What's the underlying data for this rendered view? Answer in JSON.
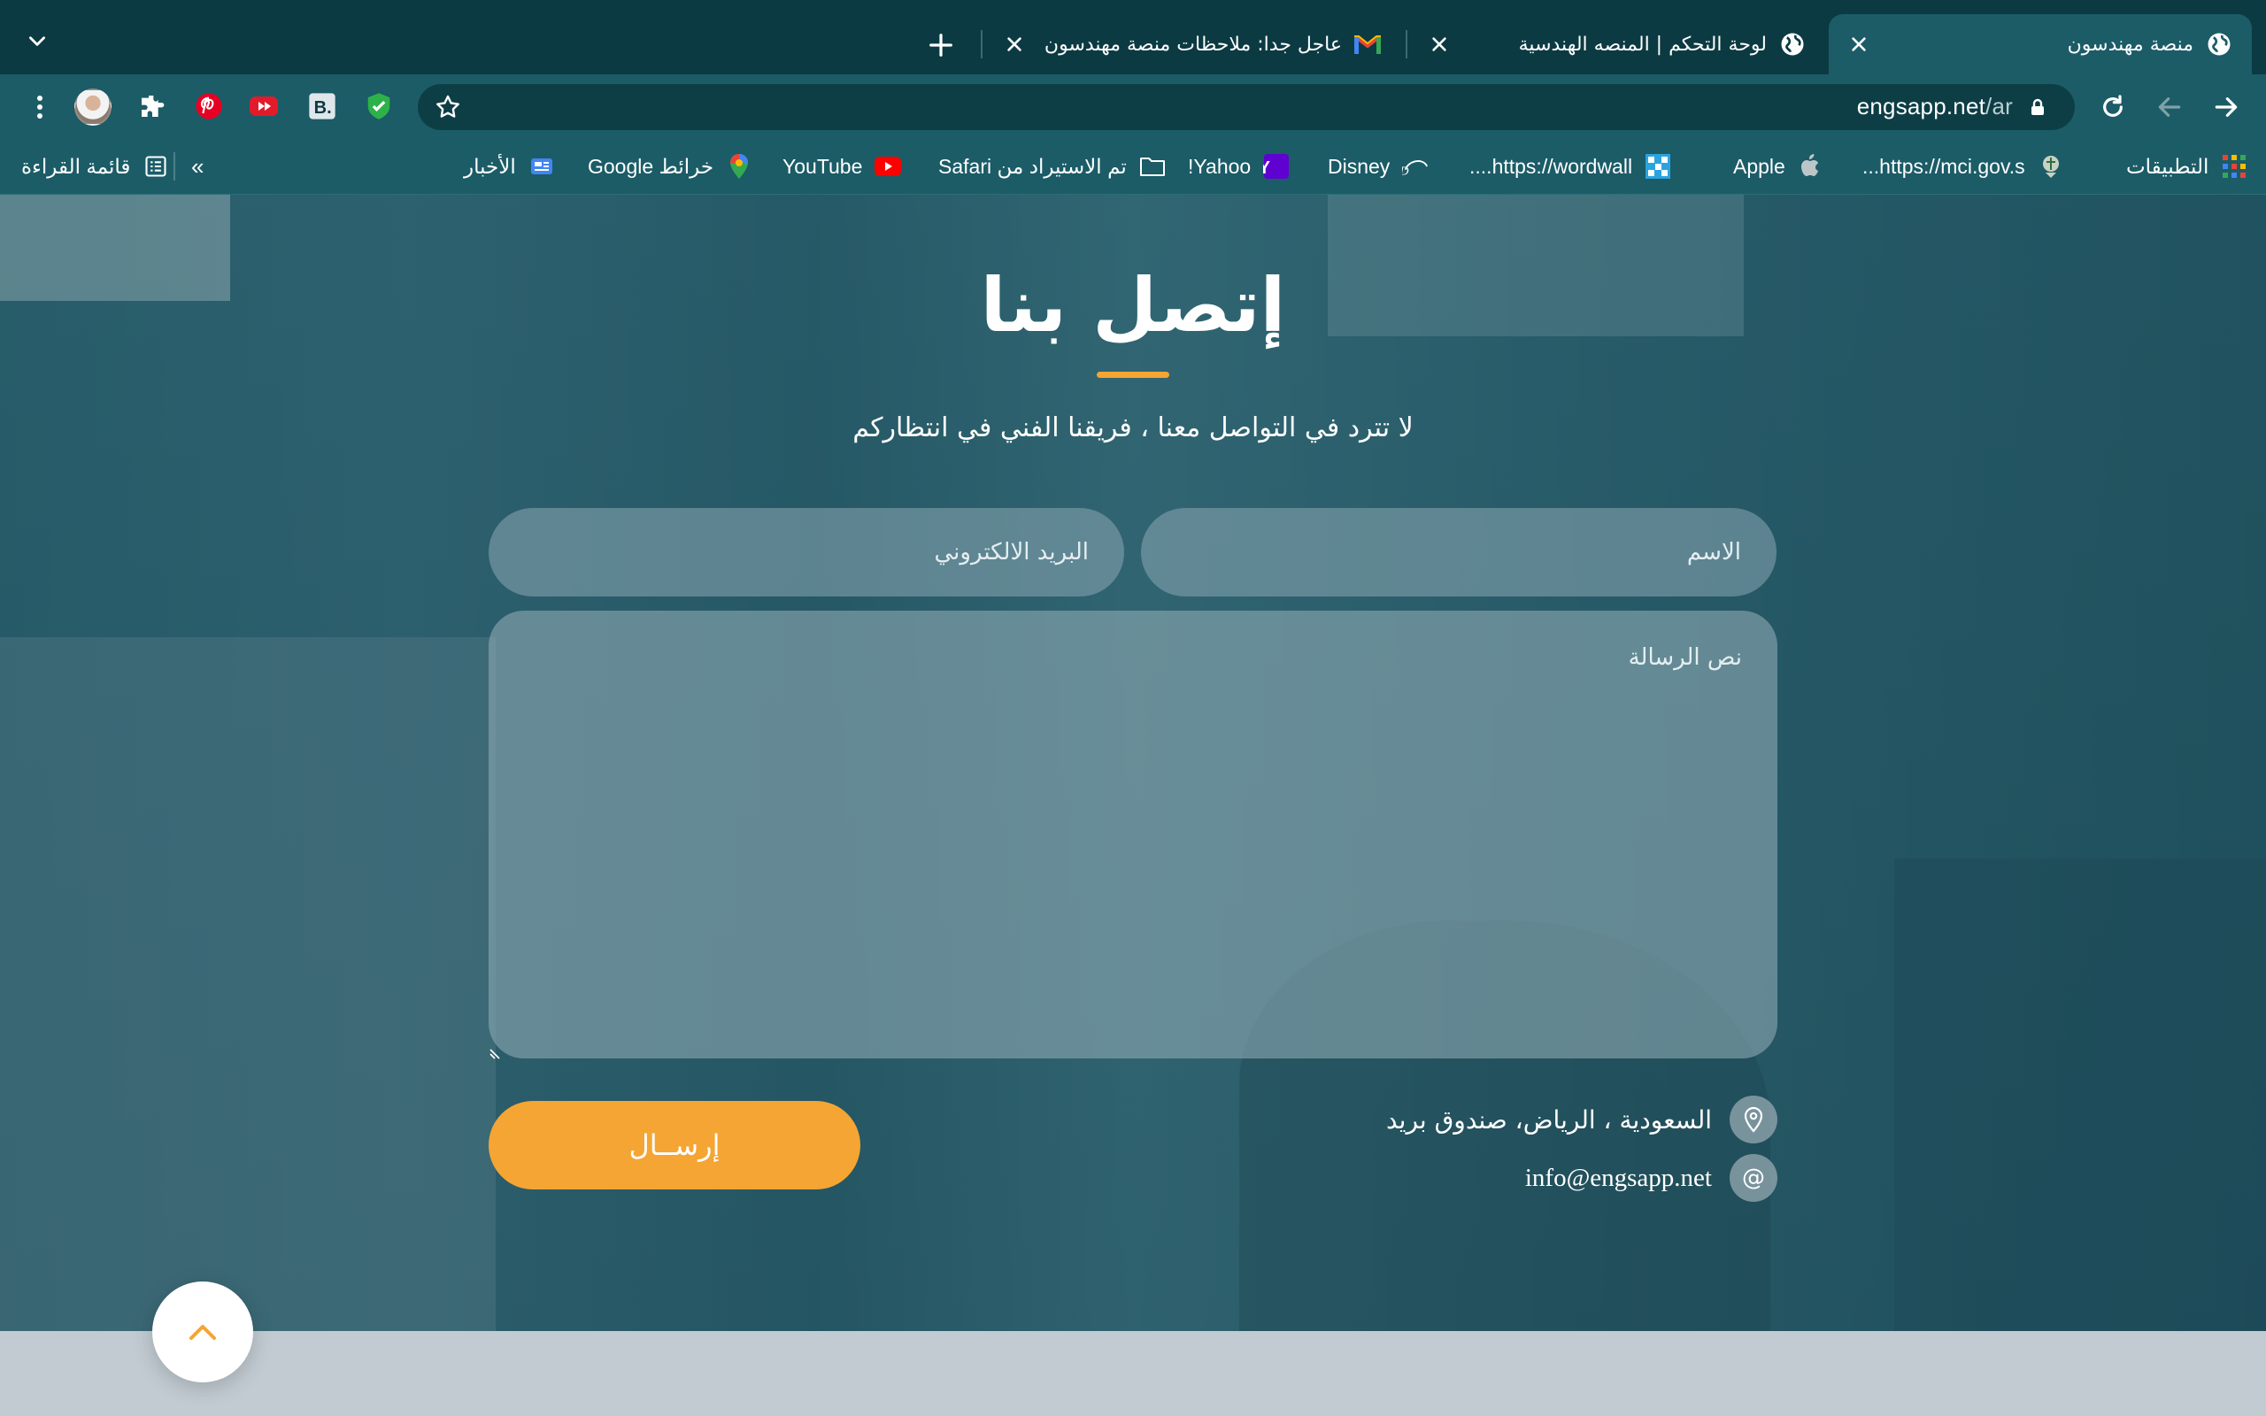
{
  "browser": {
    "tabs": [
      {
        "title": "منصة مهندسون",
        "active": true,
        "favicon": "globe-icon"
      },
      {
        "title": "لوحة التحكم | المنصه الهندسية",
        "active": false,
        "favicon": "globe-icon"
      },
      {
        "title": "عاجل جدا: ملاحظات منصة مهندسون - ا",
        "active": false,
        "favicon": "gmail-icon"
      }
    ],
    "url_host": "engsapp.net",
    "url_path": "/ar",
    "bookmarks": [
      {
        "label": "التطبيقات",
        "icon": "apps-grid-icon"
      },
      {
        "label": "https://mci.gov.s...",
        "icon": "emblem-icon"
      },
      {
        "label": "Apple",
        "icon": "apple-icon"
      },
      {
        "label": "https://wordwall....",
        "icon": "wordwall-icon"
      },
      {
        "label": "Disney",
        "icon": "disney-icon"
      },
      {
        "label": "Yahoo!",
        "icon": "yahoo-icon"
      },
      {
        "label": "تم الاستيراد من Safari",
        "icon": "folder-icon"
      },
      {
        "label": "YouTube",
        "icon": "youtube-icon"
      },
      {
        "label": "خرائط Google",
        "icon": "maps-pin-icon"
      },
      {
        "label": "الأخبار",
        "icon": "news-icon"
      }
    ],
    "overflow_label": "»",
    "reading_list_label": "قائمة القراءة"
  },
  "page": {
    "title": "إتصل بنا",
    "subtitle": "لا تترد في التواصل معنا ، فريقنا الفني في انتظاركم",
    "form": {
      "name_placeholder": "الاسم",
      "email_placeholder": "البريد الالكتروني",
      "message_placeholder": "نص الرسالة",
      "submit_label": "إرســال"
    },
    "contact": {
      "address": "السعودية ، الرياض، صندوق بريد",
      "email": "info@engsapp.net",
      "email_icon_glyph": "@"
    },
    "colors": {
      "accent": "#f5a533",
      "header_dark": "#0c3a42",
      "toolbar": "#1b5c67"
    }
  }
}
